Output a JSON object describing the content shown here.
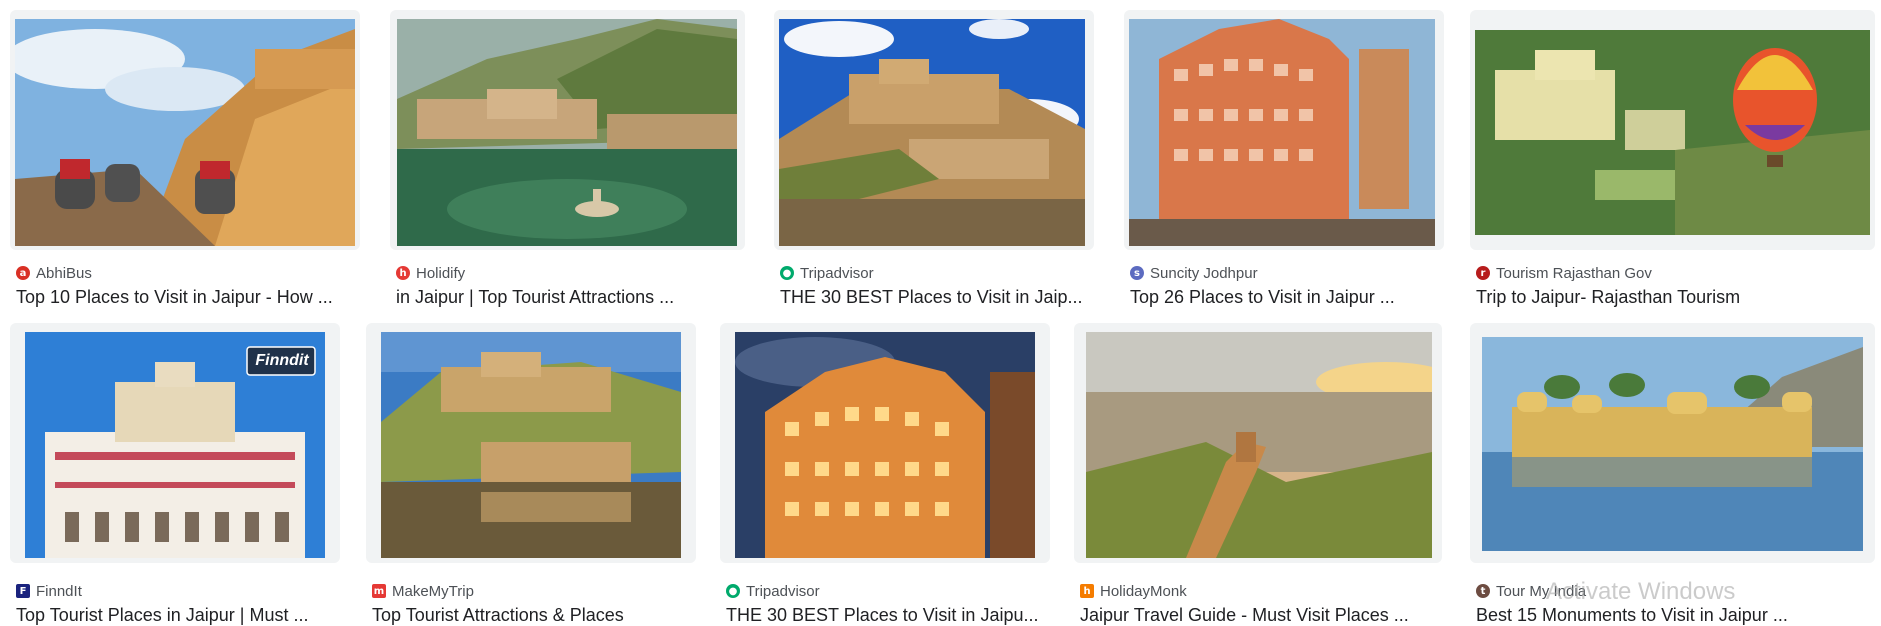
{
  "results": [
    {
      "source": "AbhiBus",
      "title": "Top 10 Places to Visit in Jaipur - How ...",
      "favicon": "abhibus-icon",
      "favicon_color": "#d93025"
    },
    {
      "source": "Holidify",
      "title": "in Jaipur | Top Tourist Attractions ...",
      "favicon": "holidify-icon",
      "favicon_color": "#e53935"
    },
    {
      "source": "Tripadvisor",
      "title": "THE 30 BEST Places to Visit in Jaip...",
      "favicon": "tripadvisor-owl-icon",
      "favicon_color": "#00aa6c"
    },
    {
      "source": "Suncity Jodhpur",
      "title": "Top 26 Places to Visit in Jaipur ...",
      "favicon": "suncity-icon",
      "favicon_color": "#5c6bc0"
    },
    {
      "source": "Tourism Rajasthan Gov",
      "title": "Trip to Jaipur- Rajasthan Tourism",
      "favicon": "rajasthan-gov-icon",
      "favicon_color": "#b71c1c"
    },
    {
      "source": "FinndIt",
      "title": "Top Tourist Places in Jaipur | Must ...",
      "favicon": "finndit-icon",
      "favicon_color": "#1a237e"
    },
    {
      "source": "MakeMyTrip",
      "title": "Top Tourist Attractions & Places",
      "favicon": "makemytrip-icon",
      "favicon_color": "#e53935"
    },
    {
      "source": "Tripadvisor",
      "title": "THE 30 BEST Places to Visit in Jaipu...",
      "favicon": "tripadvisor-owl-icon",
      "favicon_color": "#00aa6c"
    },
    {
      "source": "HolidayMonk",
      "title": "Jaipur Travel Guide - Must Visit Places ...",
      "favicon": "holidaymonk-icon",
      "favicon_color": "#f57c00"
    },
    {
      "source": "Tour My India",
      "title": "Best 15 Monuments to Visit in Jaipur ...",
      "favicon": "tourmyindia-icon",
      "favicon_color": "#6d4c41"
    }
  ],
  "image_overlay_text": "Finndit",
  "watermark": "Activate Windows"
}
